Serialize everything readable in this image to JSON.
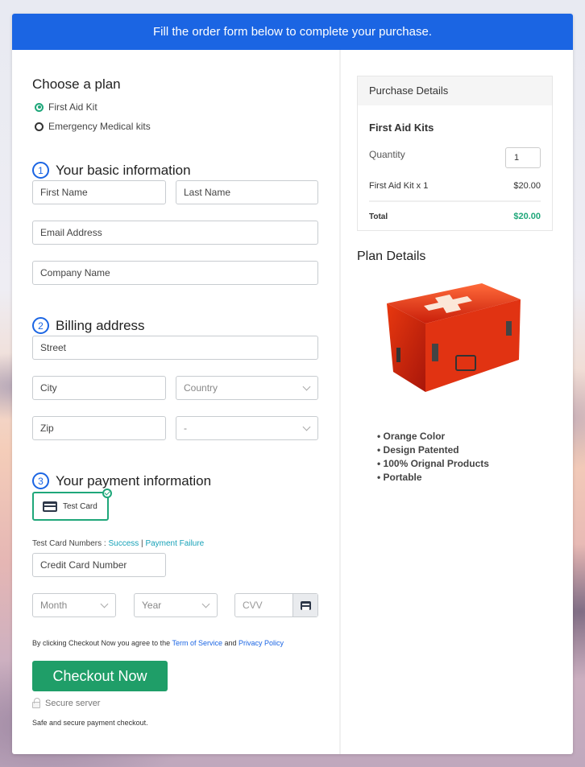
{
  "banner": {
    "text": "Fill the order form below to complete your purchase."
  },
  "plan": {
    "heading": "Choose a plan",
    "options": [
      {
        "label": "First Aid Kit",
        "selected": true
      },
      {
        "label": "Emergency Medical kits",
        "selected": false
      }
    ]
  },
  "basic_info": {
    "step": "1",
    "heading": "Your basic information",
    "first_name_placeholder": "First Name",
    "last_name_placeholder": "Last Name",
    "email_placeholder": "Email Address",
    "company_placeholder": "Company Name"
  },
  "billing": {
    "step": "2",
    "heading": "Billing address",
    "street_placeholder": "Street",
    "city_placeholder": "City",
    "country_selected": "Country",
    "zip_placeholder": "Zip",
    "state_selected": "-"
  },
  "payment": {
    "step": "3",
    "heading": "Your payment information",
    "method_label": "Test Card",
    "test_numbers_label": "Test Card Numbers : ",
    "success_link": "Success",
    "separator": " | ",
    "failure_link": "Payment Failure",
    "card_number_placeholder": "Credit Card Number",
    "month_selected": "Month",
    "year_selected": "Year",
    "cvv_placeholder": "CVV"
  },
  "agreement": {
    "prefix": "By clicking Checkout Now you agree to the ",
    "terms_link": "Term of Service",
    "middle": " and ",
    "privacy_link": "Privacy Policy"
  },
  "checkout": {
    "button_label": "Checkout Now",
    "secure_label": "Secure server",
    "safe_text": "Safe and secure payment checkout."
  },
  "purchase_details": {
    "heading": "Purchase Details",
    "product_title": "First Aid Kits",
    "quantity_label": "Quantity",
    "quantity_value": "1",
    "line_item_label": "First Aid Kit x 1",
    "line_item_price": "$20.00",
    "total_label": "Total",
    "total_value": "$20.00"
  },
  "plan_details": {
    "heading": "Plan Details",
    "image_alt": "Red first aid kit case",
    "features": [
      "Orange Color",
      "Design Patented",
      "100% Orignal Products",
      "Portable"
    ]
  },
  "colors": {
    "brand_blue": "#1b65e3",
    "success_green": "#1f9e68",
    "teal_link": "#17a2b8"
  }
}
